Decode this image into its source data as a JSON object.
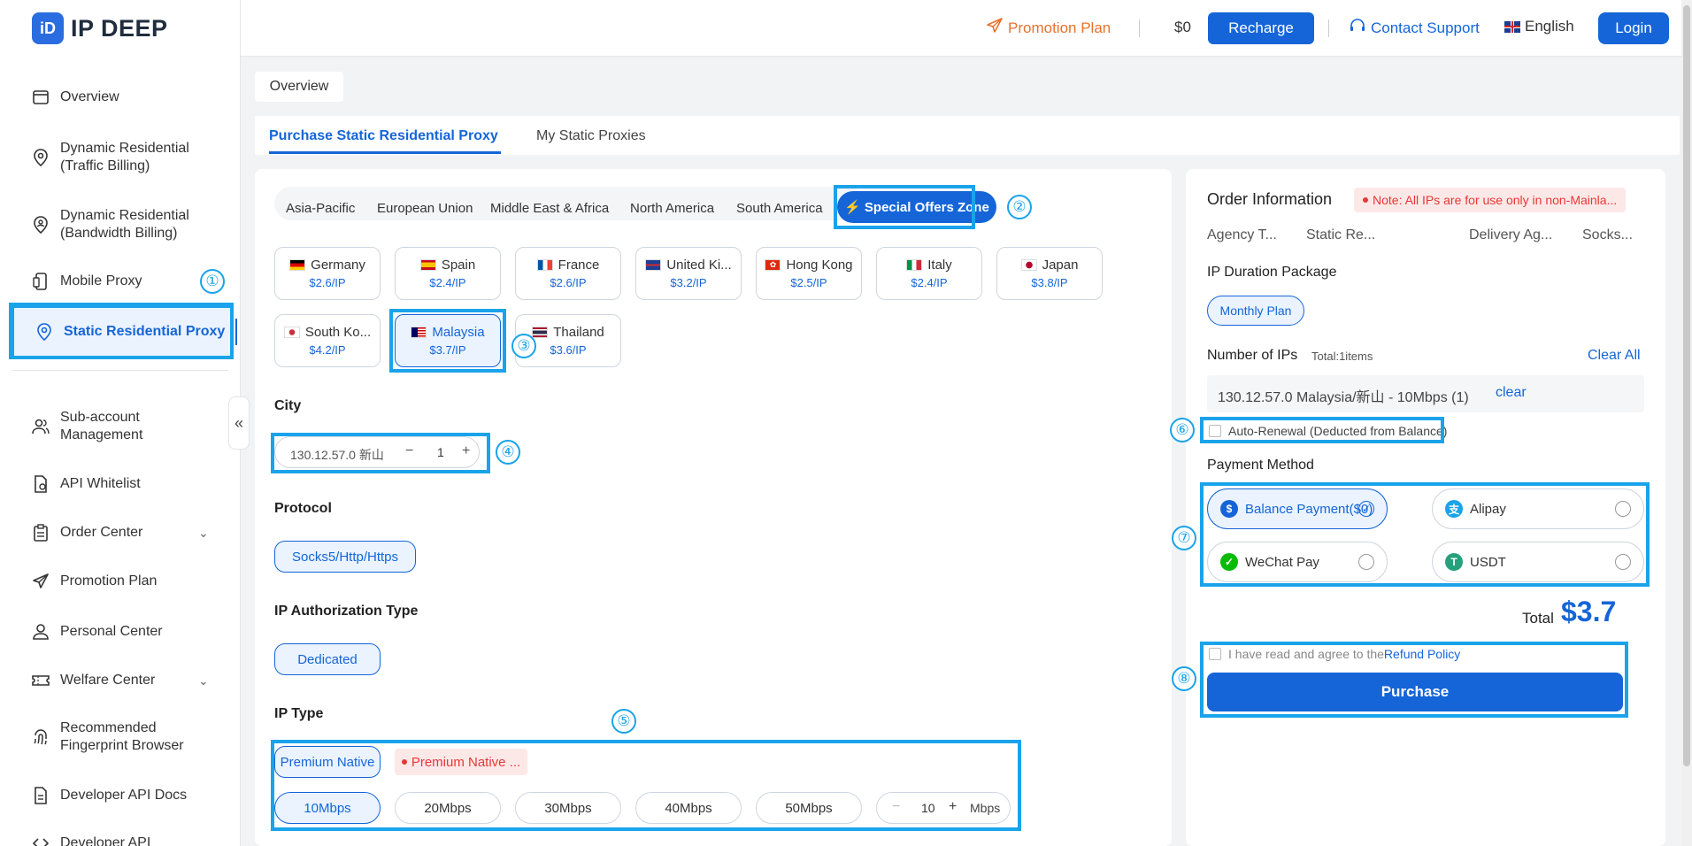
{
  "app": {
    "logo_mark": "iD",
    "logo_text": "IP DEEP"
  },
  "sidebar": {
    "items": [
      {
        "label": "Overview"
      },
      {
        "label": "Dynamic Residential (Traffic Billing)"
      },
      {
        "label": "Dynamic Residential (Bandwidth Billing)"
      },
      {
        "label": "Mobile Proxy"
      },
      {
        "label": "Static Residential Proxy"
      },
      {
        "label": "Sub-account Management"
      },
      {
        "label": "API Whitelist"
      },
      {
        "label": "Order Center"
      },
      {
        "label": "Promotion Plan"
      },
      {
        "label": "Personal Center"
      },
      {
        "label": "Welfare Center"
      },
      {
        "label": "Recommended Fingerprint Browser"
      },
      {
        "label": "Developer API Docs"
      },
      {
        "label": "Developer API"
      }
    ],
    "collapse_glyph": "«"
  },
  "header": {
    "promotion": "Promotion Plan",
    "balance": "$0",
    "recharge": "Recharge",
    "support": "Contact Support",
    "language": "English",
    "login": "Login"
  },
  "breadcrumb": "Overview",
  "tabs": [
    {
      "label": "Purchase Static Residential Proxy",
      "active": true
    },
    {
      "label": "My Static Proxies",
      "active": false
    }
  ],
  "regions": [
    "Asia-Pacific",
    "European Union",
    "Middle East & Africa",
    "North America",
    "South America"
  ],
  "special_offers": "Special Offers Zone",
  "countries": [
    {
      "name": "Germany",
      "price": "$2.6/IP"
    },
    {
      "name": "Spain",
      "price": "$2.4/IP"
    },
    {
      "name": "France",
      "price": "$2.6/IP"
    },
    {
      "name": "United Ki...",
      "price": "$3.2/IP"
    },
    {
      "name": "Hong Kong",
      "price": "$2.5/IP"
    },
    {
      "name": "Italy",
      "price": "$2.4/IP"
    },
    {
      "name": "Japan",
      "price": "$3.8/IP"
    },
    {
      "name": "South Ko...",
      "price": "$4.2/IP"
    },
    {
      "name": "Malaysia",
      "price": "$3.7/IP",
      "selected": true
    },
    {
      "name": "Thailand",
      "price": "$3.6/IP"
    }
  ],
  "city": {
    "title": "City",
    "value": "130.12.57.0 新山",
    "quantity": "1",
    "minus": "−",
    "plus": "+"
  },
  "protocol": {
    "title": "Protocol",
    "value": "Socks5/Http/Https"
  },
  "auth": {
    "title": "IP Authorization Type",
    "value": "Dedicated"
  },
  "ip_type": {
    "title": "IP Type",
    "options": [
      "Premium Native",
      "Premium Native ..."
    ],
    "bandwidths": [
      "10Mbps",
      "20Mbps",
      "30Mbps",
      "40Mbps",
      "50Mbps"
    ],
    "custom_value": "10",
    "custom_unit": "Mbps"
  },
  "order": {
    "title": "Order Information",
    "note": "Note: All IPs are for use only in non-Mainla...",
    "columns": [
      "Agency T...",
      "Static Re...",
      "Delivery Ag...",
      "Socks..."
    ],
    "duration_title": "IP Duration Package",
    "duration_value": "Monthly Plan",
    "ips_title": "Number of IPs",
    "ips_total": "Total:1items",
    "clear_all": "Clear All",
    "ip_entry": "130.12.57.0 Malaysia/新山 - 10Mbps (1)",
    "ip_clear": "clear",
    "auto_renewal": "Auto-Renewal (Deducted from Balance)",
    "payment_title": "Payment Method",
    "payments": [
      {
        "label": "Balance Payment($0)",
        "icon": "$"
      },
      {
        "label": "Alipay",
        "icon": "支"
      },
      {
        "label": "WeChat Pay",
        "icon": "✓"
      },
      {
        "label": "USDT",
        "icon": "T"
      }
    ],
    "total_label": "Total",
    "total_value": "$3.7",
    "agree_text": "I have read and agree to the",
    "refund_policy": "Refund Policy",
    "purchase": "Purchase"
  },
  "annotations": [
    "①",
    "②",
    "③",
    "④",
    "⑤",
    "⑥",
    "⑦",
    "⑧"
  ],
  "colors": {
    "accent": "#1565d8",
    "highlight": "#1aa3ea",
    "promo": "#e8722c",
    "note_red": "#e53935"
  }
}
